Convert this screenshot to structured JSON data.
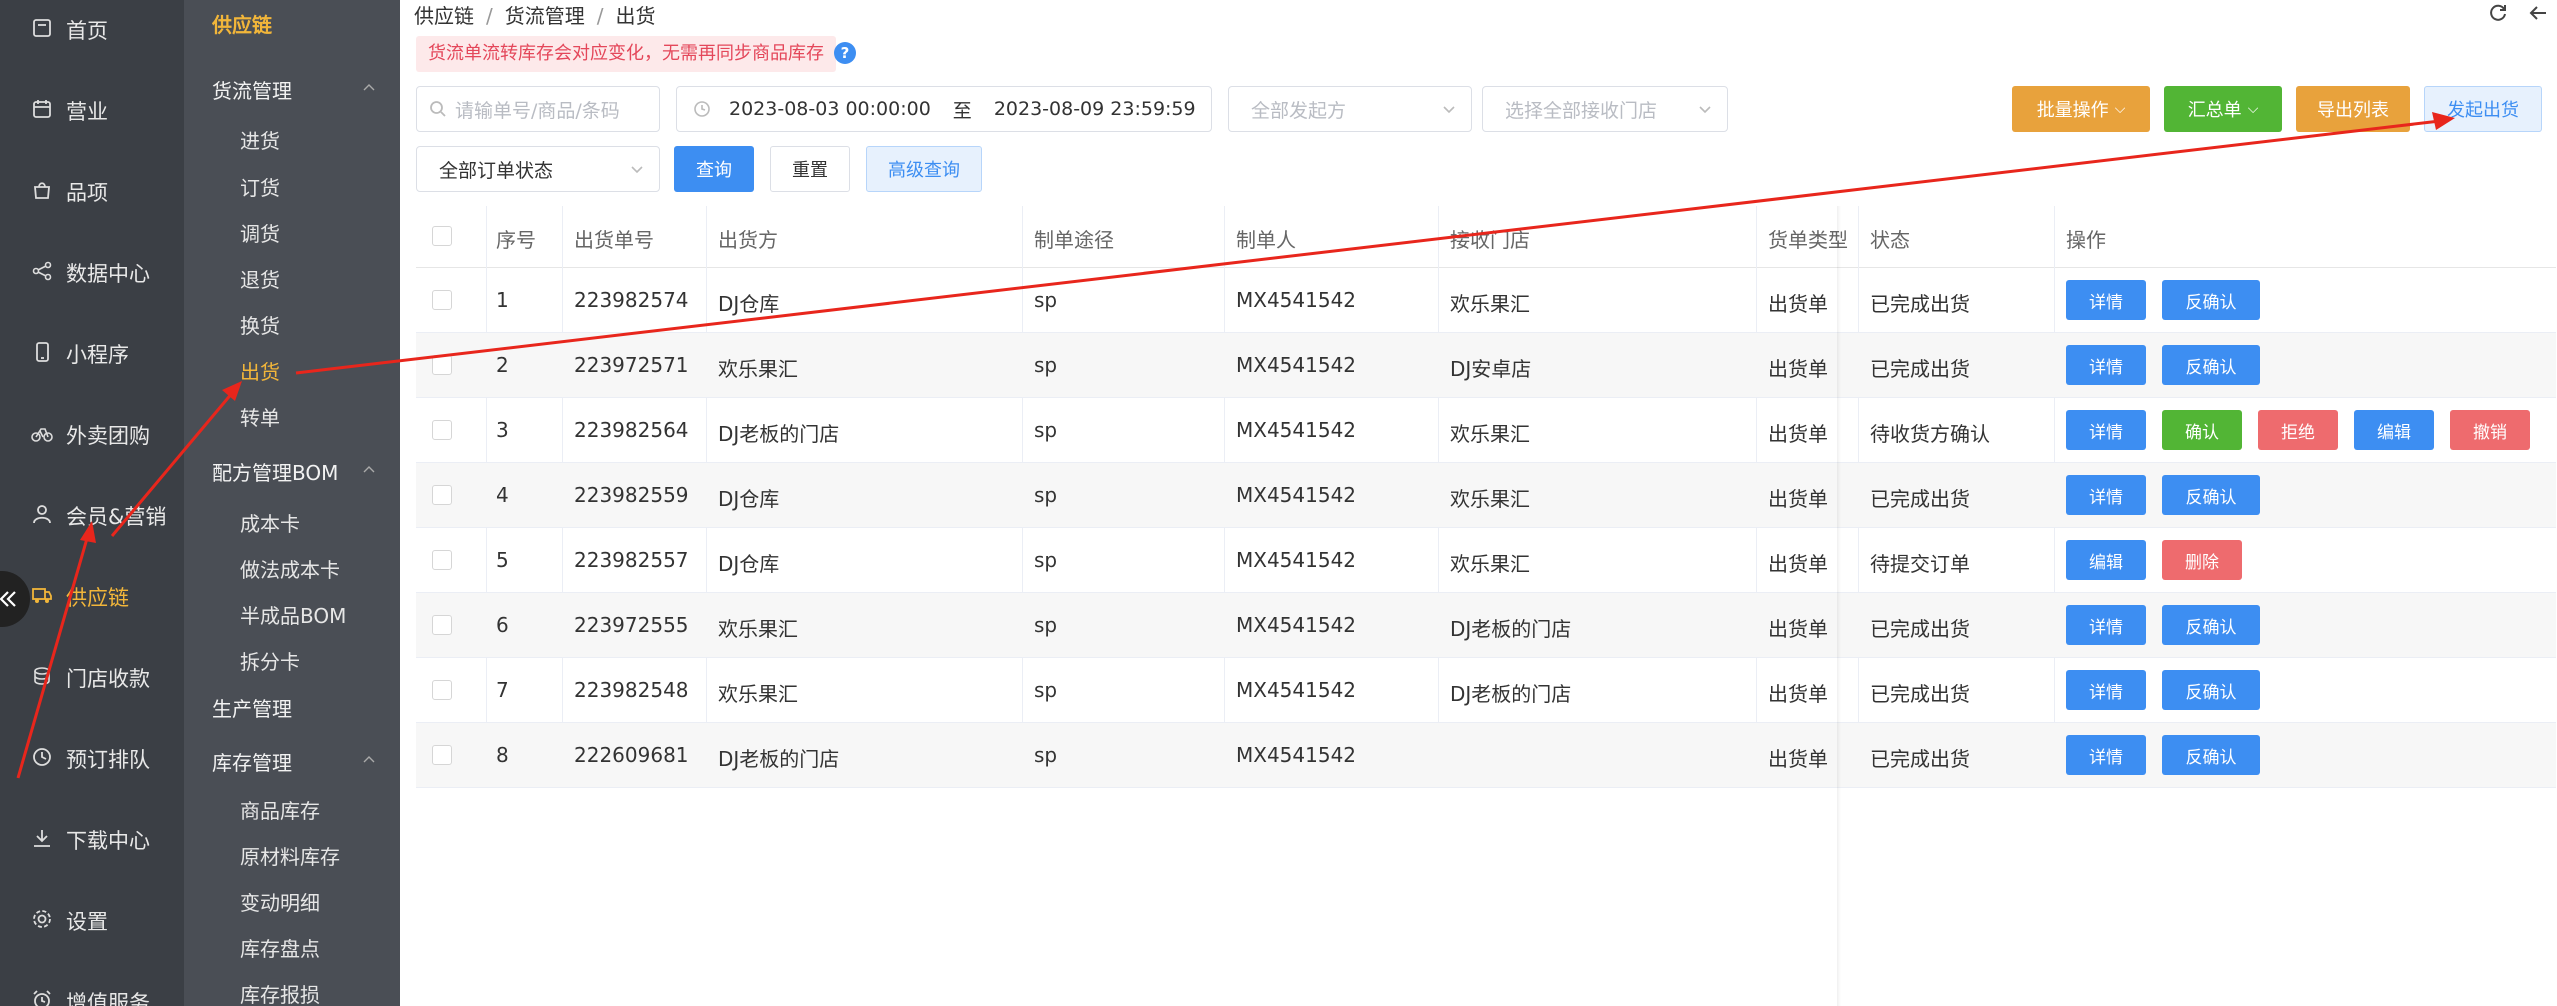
{
  "nav": [
    {
      "label": "首页",
      "icon": "dashboard-icon"
    },
    {
      "label": "营业",
      "icon": "calendar-icon"
    },
    {
      "label": "品项",
      "icon": "bag-icon"
    },
    {
      "label": "数据中心",
      "icon": "share-icon"
    },
    {
      "label": "小程序",
      "icon": "phone-icon"
    },
    {
      "label": "外卖团购",
      "icon": "bike-icon"
    },
    {
      "label": "会员&营销",
      "icon": "user-icon"
    },
    {
      "label": "供应链",
      "icon": "truck-icon"
    },
    {
      "label": "门店收款",
      "icon": "coins-icon"
    },
    {
      "label": "预订排队",
      "icon": "clock-icon"
    },
    {
      "label": "下载中心",
      "icon": "download-icon"
    },
    {
      "label": "设置",
      "icon": "gear-icon"
    },
    {
      "label": "增值服务",
      "icon": "alarm-icon"
    }
  ],
  "subnav": {
    "title": "供应链",
    "items": [
      {
        "label": "货流管理",
        "type": "group"
      },
      {
        "label": "进货",
        "type": "sub"
      },
      {
        "label": "订货",
        "type": "sub"
      },
      {
        "label": "调货",
        "type": "sub"
      },
      {
        "label": "退货",
        "type": "sub"
      },
      {
        "label": "换货",
        "type": "sub"
      },
      {
        "label": "出货",
        "type": "sub"
      },
      {
        "label": "转单",
        "type": "sub"
      },
      {
        "label": "配方管理BOM",
        "type": "group"
      },
      {
        "label": "成本卡",
        "type": "sub"
      },
      {
        "label": "做法成本卡",
        "type": "sub"
      },
      {
        "label": "半成品BOM",
        "type": "sub"
      },
      {
        "label": "拆分卡",
        "type": "sub"
      },
      {
        "label": "生产管理",
        "type": "group"
      },
      {
        "label": "库存管理",
        "type": "group"
      },
      {
        "label": "商品库存",
        "type": "sub"
      },
      {
        "label": "原材料库存",
        "type": "sub"
      },
      {
        "label": "变动明细",
        "type": "sub"
      },
      {
        "label": "库存盘点",
        "type": "sub"
      },
      {
        "label": "库存报损",
        "type": "sub"
      }
    ]
  },
  "breadcrumb": [
    "供应链",
    "货流管理",
    "出货"
  ],
  "tip": "货流单流转库存会对应变化，无需再同步商品库存",
  "help": "?",
  "filters": {
    "search_placeholder": "请输单号/商品/条码",
    "date_start": "2023-08-03 00:00:00",
    "date_to": "至",
    "date_end": "2023-08-09 23:59:59",
    "sender": "全部发起方",
    "receiver": "选择全部接收门店",
    "status": "全部订单状态",
    "query": "查询",
    "reset": "重置",
    "advanced": "高级查询"
  },
  "actions": {
    "batch": "批量操作",
    "summary": "汇总单",
    "export": "导出列表",
    "create": "发起出货"
  },
  "columns": [
    "序号",
    "出货单号",
    "出货方",
    "制单途径",
    "制单人",
    "接收门店",
    "货单类型",
    "状态",
    "操作"
  ],
  "rows": [
    {
      "no": "1",
      "order": "223982574",
      "from": "DJ仓库",
      "via": "sp",
      "maker": "MX4541542",
      "to": "欢乐果汇",
      "type": "出货单",
      "status": "已完成出货",
      "ops": [
        "详情",
        "反确认"
      ]
    },
    {
      "no": "2",
      "order": "223972571",
      "from": "欢乐果汇",
      "via": "sp",
      "maker": "MX4541542",
      "to": "DJ安卓店",
      "type": "出货单",
      "status": "已完成出货",
      "ops": [
        "详情",
        "反确认"
      ]
    },
    {
      "no": "3",
      "order": "223982564",
      "from": "DJ老板的门店",
      "via": "sp",
      "maker": "MX4541542",
      "to": "欢乐果汇",
      "type": "出货单",
      "status": "待收货方确认",
      "ops": [
        "详情",
        "确认",
        "拒绝",
        "编辑",
        "撤销"
      ]
    },
    {
      "no": "4",
      "order": "223982559",
      "from": "DJ仓库",
      "via": "sp",
      "maker": "MX4541542",
      "to": "欢乐果汇",
      "type": "出货单",
      "status": "已完成出货",
      "ops": [
        "详情",
        "反确认"
      ]
    },
    {
      "no": "5",
      "order": "223982557",
      "from": "DJ仓库",
      "via": "sp",
      "maker": "MX4541542",
      "to": "欢乐果汇",
      "type": "出货单",
      "status": "待提交订单",
      "ops": [
        "编辑",
        "删除"
      ]
    },
    {
      "no": "6",
      "order": "223972555",
      "from": "欢乐果汇",
      "via": "sp",
      "maker": "MX4541542",
      "to": "DJ老板的门店",
      "type": "出货单",
      "status": "已完成出货",
      "ops": [
        "详情",
        "反确认"
      ]
    },
    {
      "no": "7",
      "order": "223982548",
      "from": "欢乐果汇",
      "via": "sp",
      "maker": "MX4541542",
      "to": "DJ老板的门店",
      "type": "出货单",
      "status": "已完成出货",
      "ops": [
        "详情",
        "反确认"
      ]
    },
    {
      "no": "8",
      "order": "222609681",
      "from": "DJ老板的门店",
      "via": "sp",
      "maker": "MX4541542",
      "to": "",
      "type": "出货单",
      "status": "已完成出货",
      "ops": [
        "详情",
        "反确认"
      ]
    }
  ],
  "colors": {
    "accent": "#f2b63a",
    "primary": "#3d8ef2",
    "success": "#52b535",
    "danger": "#ee6b6e",
    "warning": "#e8a23c",
    "annotation": "#e8261c"
  }
}
